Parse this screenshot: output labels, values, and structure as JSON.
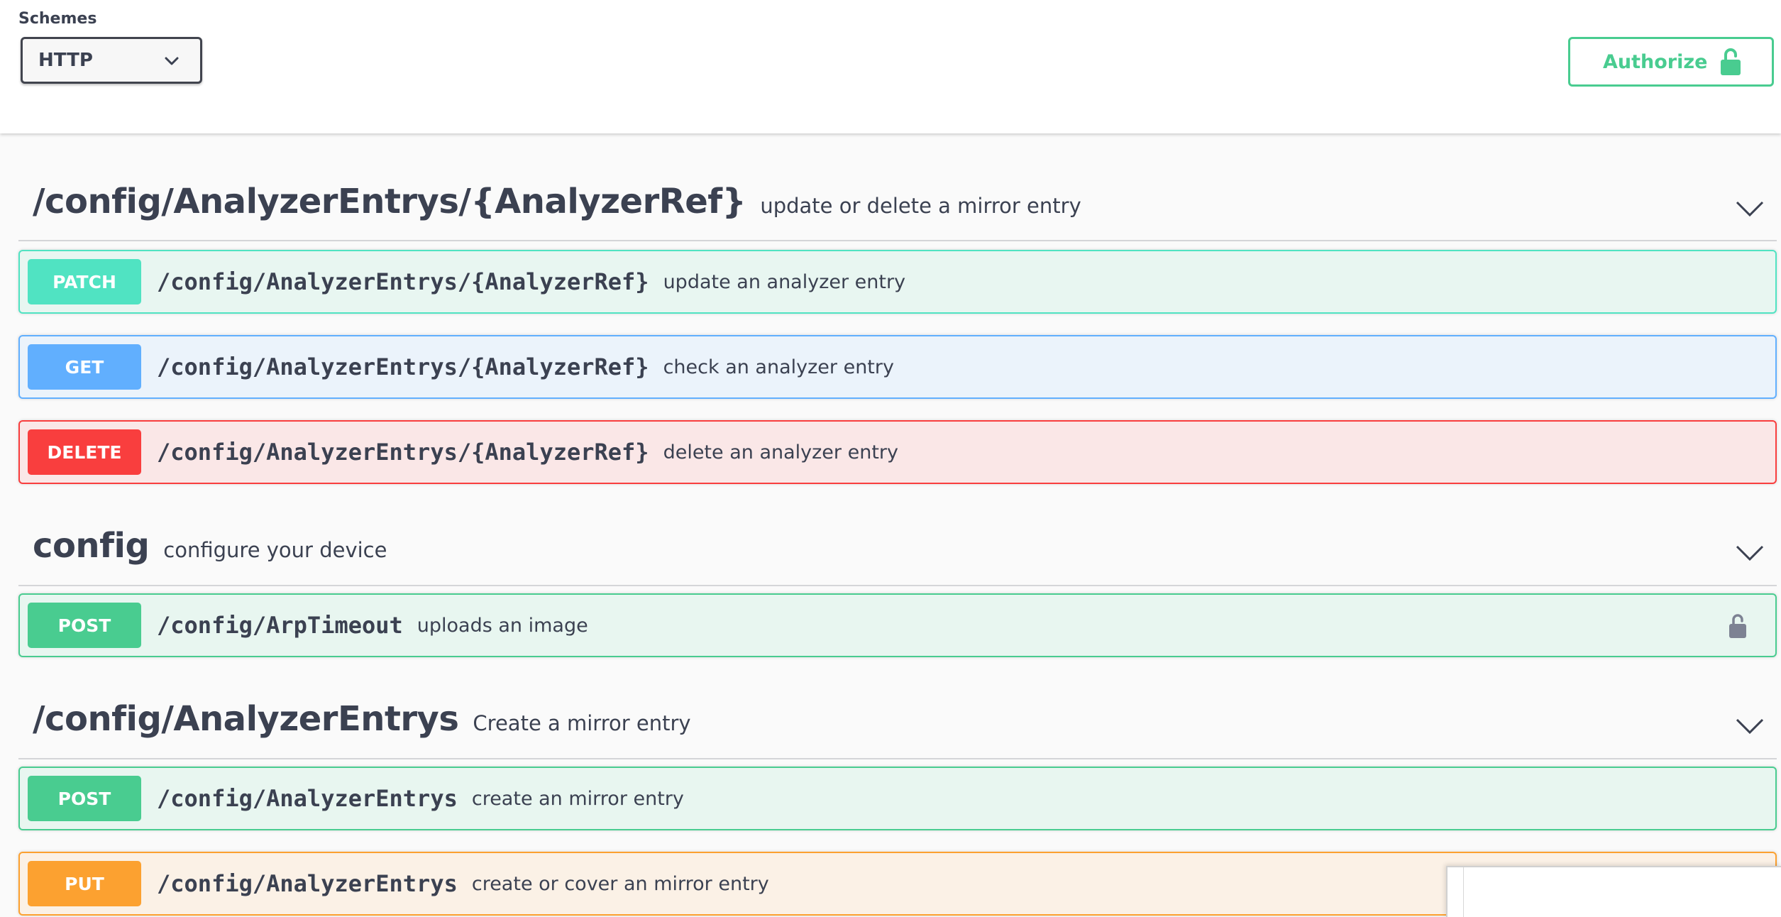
{
  "schemes": {
    "title": "Schemes",
    "selected": "HTTP"
  },
  "authorize": {
    "label": "Authorize"
  },
  "tags": [
    {
      "name": "/config/AnalyzerEntrys/{AnalyzerRef}",
      "description": "update or delete a mirror entry",
      "operations": [
        {
          "method": "PATCH",
          "path": "/config/AnalyzerEntrys/{AnalyzerRef}",
          "summary": "update an analyzer entry"
        },
        {
          "method": "GET",
          "path": "/config/AnalyzerEntrys/{AnalyzerRef}",
          "summary": "check an analyzer entry"
        },
        {
          "method": "DELETE",
          "path": "/config/AnalyzerEntrys/{AnalyzerRef}",
          "summary": "delete an analyzer entry"
        }
      ]
    },
    {
      "name": "config",
      "description": "configure your device",
      "operations": [
        {
          "method": "POST",
          "path": "/config/ArpTimeout",
          "summary": "uploads an image",
          "locked": true
        }
      ]
    },
    {
      "name": "/config/AnalyzerEntrys",
      "description": "Create a mirror entry",
      "operations": [
        {
          "method": "POST",
          "path": "/config/AnalyzerEntrys",
          "summary": "create an mirror entry"
        },
        {
          "method": "PUT",
          "path": "/config/AnalyzerEntrys",
          "summary": "create or cover an mirror entry"
        }
      ]
    }
  ],
  "colors": {
    "patch": "#50e3c2",
    "get": "#61affe",
    "delete": "#f93e3e",
    "post": "#49cc90",
    "put": "#fca130",
    "text": "#3b4151"
  }
}
